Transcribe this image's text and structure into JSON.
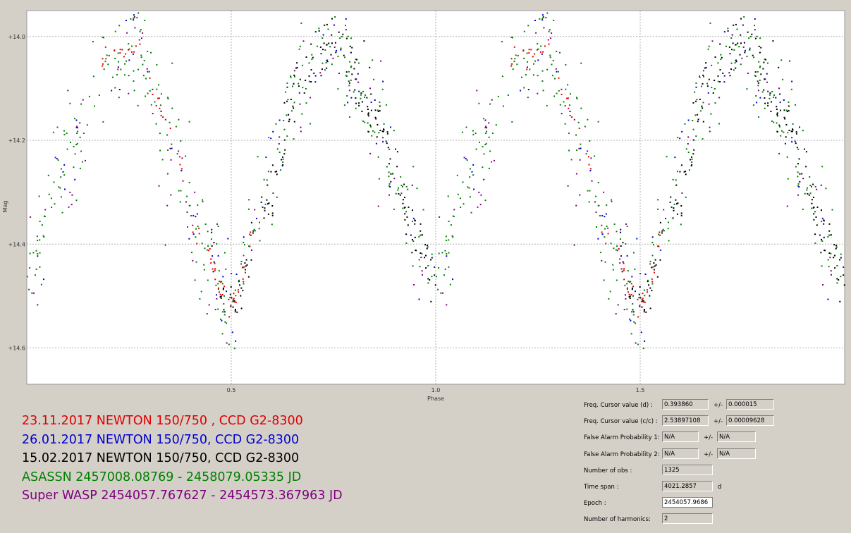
{
  "chart_data": {
    "type": "scatter",
    "xlabel": "Phase",
    "ylabel": "Mag",
    "xlim": [
      0.0,
      2.0
    ],
    "ylim": [
      13.95,
      14.67
    ],
    "y_inverted": true,
    "grid": true,
    "x_ticks": [
      {
        "v": 0.5,
        "label": "0.5"
      },
      {
        "v": 1.0,
        "label": "1.0"
      },
      {
        "v": 1.5,
        "label": "1.5"
      }
    ],
    "y_ticks": [
      {
        "v": 14.0,
        "label": "+14.0"
      },
      {
        "v": 14.2,
        "label": "+14.2"
      },
      {
        "v": 14.4,
        "label": "+14.4"
      },
      {
        "v": 14.6,
        "label": "+14.6"
      }
    ],
    "light_curve": {
      "period_phase": 1.0,
      "shape": [
        [
          0.0,
          14.46
        ],
        [
          0.1,
          14.22
        ],
        [
          0.2,
          14.04
        ],
        [
          0.27,
          14.02
        ],
        [
          0.35,
          14.18
        ],
        [
          0.42,
          14.38
        ],
        [
          0.5,
          14.52
        ],
        [
          0.58,
          14.32
        ],
        [
          0.67,
          14.08
        ],
        [
          0.75,
          14.01
        ],
        [
          0.85,
          14.15
        ],
        [
          0.95,
          14.38
        ],
        [
          1.0,
          14.46
        ]
      ]
    },
    "series": [
      {
        "name": "23.11.2017 NEWTON 150/750 , CCD G2-8300",
        "color": "#e00000",
        "n": 70,
        "phase_ranges": [
          [
            0.18,
            0.55
          ]
        ],
        "scatter": 0.012
      },
      {
        "name": "26.01.2017 NEWTON 150/750, CCD G2-8300",
        "color": "#0000d0",
        "n": 80,
        "phase_ranges": [
          [
            0.0,
            1.0
          ]
        ],
        "scatter": 0.05
      },
      {
        "name": "15.02.2017 NEWTON 150/750, CCD G2-8300",
        "color": "#000000",
        "n": 200,
        "phase_ranges": [
          [
            0.45,
            1.0
          ]
        ],
        "scatter": 0.03
      },
      {
        "name": "ASASSN 2457008.08769 - 2458079.05335 JD",
        "color": "#008000",
        "n": 360,
        "phase_ranges": [
          [
            0.0,
            1.0
          ]
        ],
        "scatter": 0.05
      },
      {
        "name": "Super WASP 2454057.767627 - 2454573.367963 JD",
        "color": "#800080",
        "n": 80,
        "phase_ranges": [
          [
            0.0,
            1.0
          ]
        ],
        "scatter": 0.07
      }
    ]
  },
  "stats": {
    "freq_d": {
      "label": "Freq. Cursor value (d) :",
      "value": "0.393860",
      "pm": "+/-",
      "err": "0.000015"
    },
    "freq_cc": {
      "label": "Freq. Cursor value (c/c) :",
      "value": "2.53897108",
      "pm": "+/-",
      "err": "0.00009628"
    },
    "fap1": {
      "label": "False Alarm Probability 1:",
      "value": "N/A",
      "pm": "+/-",
      "err": "N/A"
    },
    "fap2": {
      "label": "False Alarm Probability 2:",
      "value": "N/A",
      "pm": "+/-",
      "err": "N/A"
    },
    "nobs": {
      "label": "Number of obs :",
      "value": "1325"
    },
    "timespan": {
      "label": "Time span :",
      "value": "4021.2857",
      "unit": "d"
    },
    "epoch": {
      "label": "Epoch :",
      "value": "2454057.9686"
    },
    "harmonics": {
      "label": "Number of harmonics:",
      "value": "2"
    }
  }
}
